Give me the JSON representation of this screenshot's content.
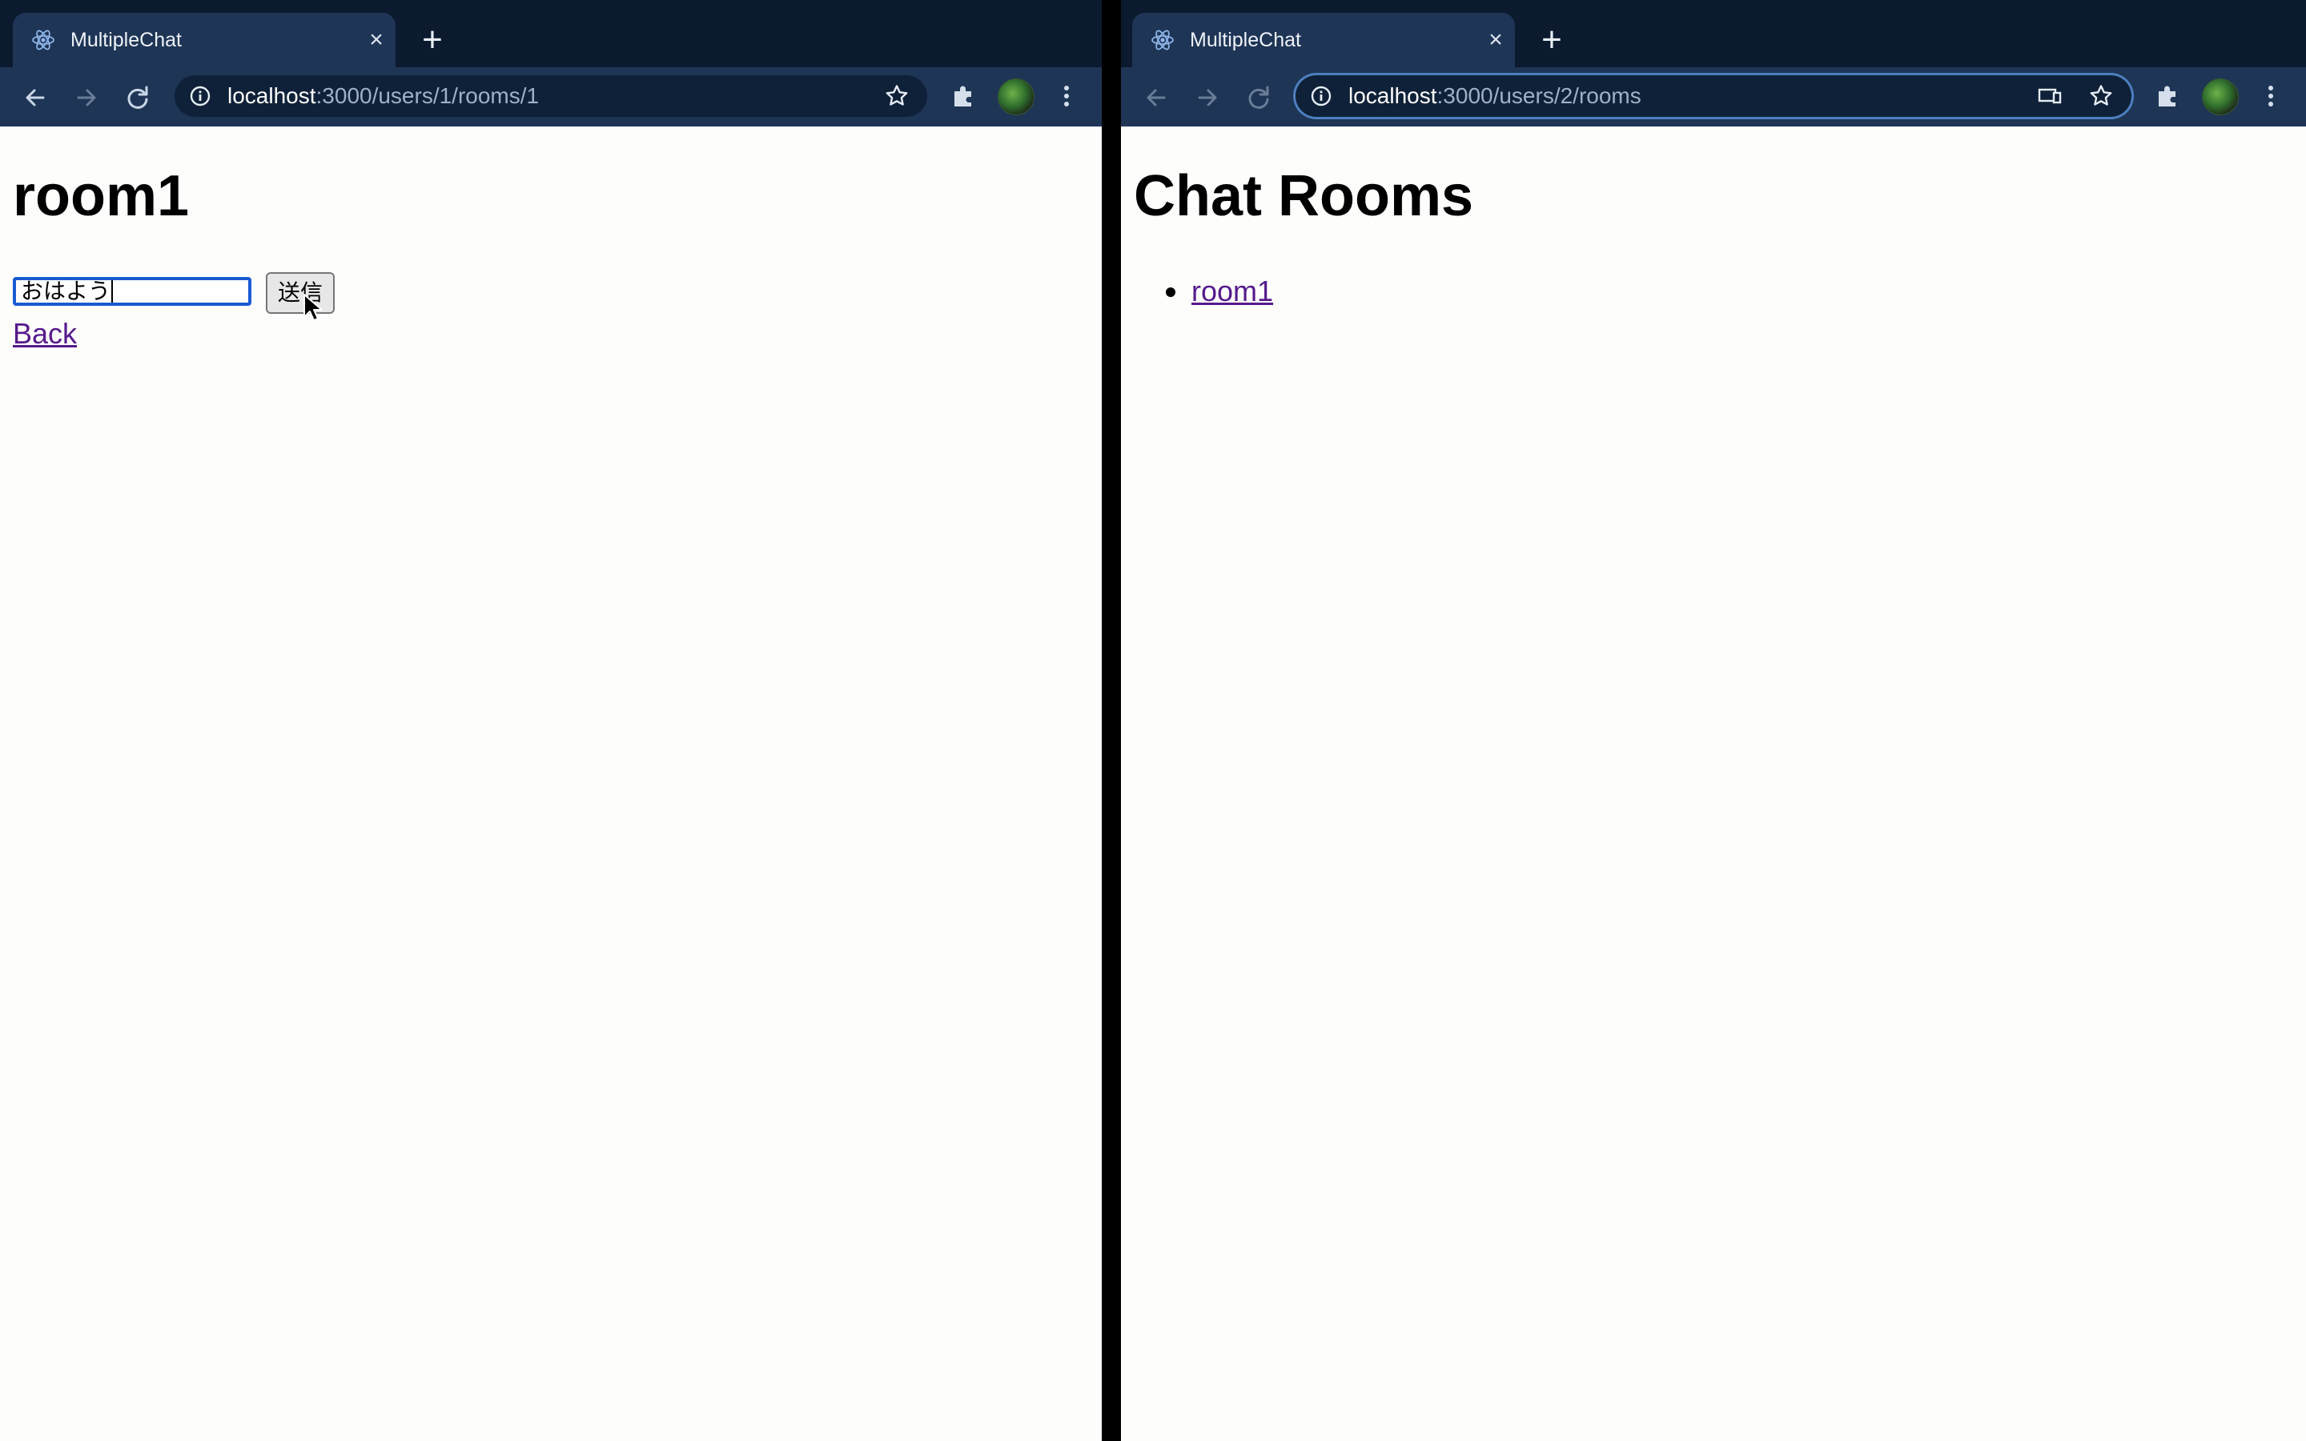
{
  "left_window": {
    "tab": {
      "title": "MultipleChat",
      "favicon": "react-atom-icon",
      "close": "×"
    },
    "new_tab_label": "+",
    "url_host": "localhost",
    "url_rest": ":3000/users/1/rooms/1",
    "page": {
      "heading": "room1",
      "message_input": {
        "value": "おはよう"
      },
      "send_button_label": "送信",
      "back_link": "Back"
    }
  },
  "right_window": {
    "tab": {
      "title": "MultipleChat",
      "favicon": "react-atom-icon",
      "close": "×"
    },
    "new_tab_label": "+",
    "url_host": "localhost",
    "url_rest": ":3000/users/2/rooms",
    "page": {
      "heading": "Chat Rooms",
      "rooms": [
        {
          "name": "room1"
        }
      ]
    }
  },
  "colors": {
    "tabstrip": "#0b1a2f",
    "toolbar": "#1e3556",
    "page_background": "#fdfdfc",
    "link_visited": "#551a8b",
    "focus_ring": "#1a5ad2",
    "divider": "#000000"
  }
}
